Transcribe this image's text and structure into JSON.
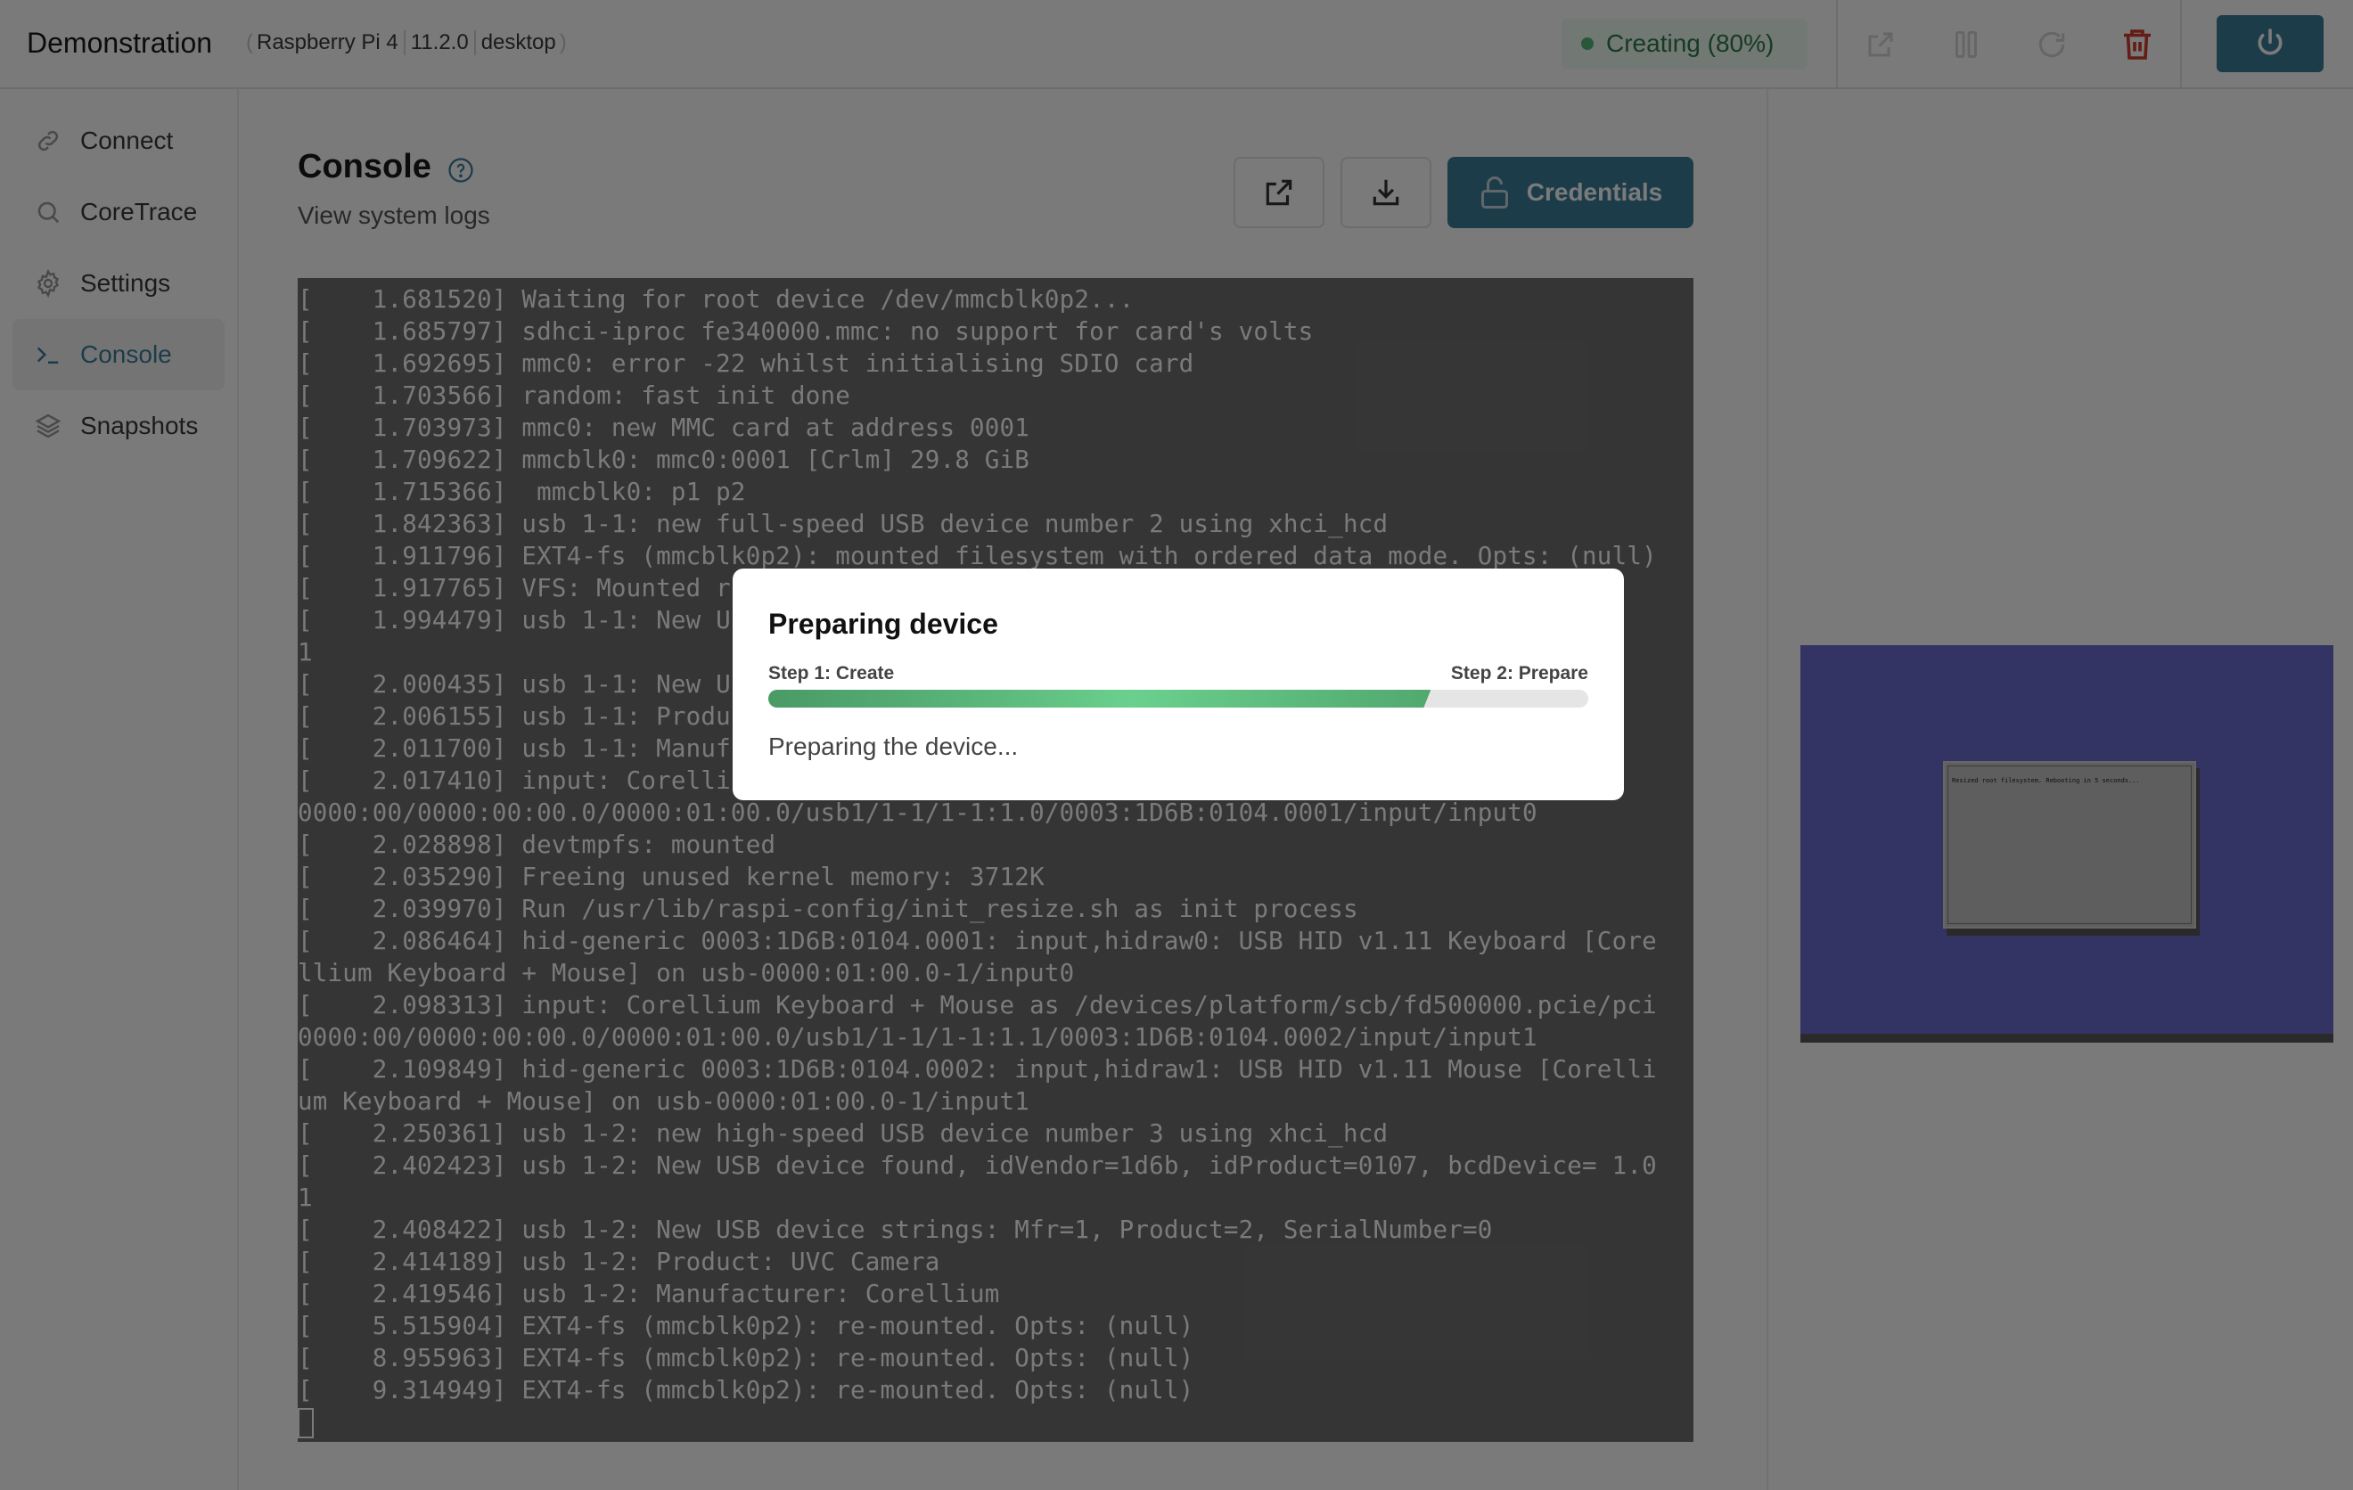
{
  "header": {
    "title": "Demonstration",
    "meta": {
      "model": "Raspberry Pi 4",
      "version": "11.2.0",
      "flavor": "desktop"
    },
    "status": {
      "label": "Creating (80%)",
      "color": "#57b779"
    },
    "icons": [
      "open-external-icon",
      "pause-icon",
      "restart-icon",
      "trash-icon",
      "power-icon"
    ]
  },
  "sidebar": {
    "items": [
      {
        "label": "Connect",
        "icon": "link-icon",
        "active": false
      },
      {
        "label": "CoreTrace",
        "icon": "search-icon",
        "active": false
      },
      {
        "label": "Settings",
        "icon": "gear-icon",
        "active": false
      },
      {
        "label": "Console",
        "icon": "terminal-icon",
        "active": true
      },
      {
        "label": "Snapshots",
        "icon": "layers-icon",
        "active": false
      }
    ]
  },
  "main": {
    "title": "Console",
    "subtitle": "View system logs",
    "buttons": {
      "credentials": "Credentials"
    },
    "console_lines": [
      "[    1.681520] Waiting for root device /dev/mmcblk0p2...",
      "[    1.685797] sdhci-iproc fe340000.mmc: no support for card's volts",
      "[    1.692695] mmc0: error -22 whilst initialising SDIO card",
      "[    1.703566] random: fast init done",
      "[    1.703973] mmc0: new MMC card at address 0001",
      "[    1.709622] mmcblk0: mmc0:0001 [Crlm] 29.8 GiB",
      "[    1.715366]  mmcblk0: p1 p2",
      "[    1.842363] usb 1-1: new full-speed USB device number 2 using xhci_hcd",
      "[    1.911796] EXT4-fs (mmcblk0p2): mounted filesystem with ordered data mode. Opts: (null)",
      "[    1.917765] VFS: Mounted r",
      "[    1.994479] usb 1-1: New U                                                        1.0",
      "1",
      "[    2.000435] usb 1-1: New U",
      "[    2.006155] usb 1-1: Produ",
      "[    2.011700] usb 1-1: Manuf",
      "[    2.017410] input: Corelli                                                        pci",
      "0000:00/0000:00:00.0/0000:01:00.0/usb1/1-1/1-1:1.0/0003:1D6B:0104.0001/input/input0",
      "[    2.028898] devtmpfs: mounted",
      "[    2.035290] Freeing unused kernel memory: 3712K",
      "[    2.039970] Run /usr/lib/raspi-config/init_resize.sh as init process",
      "[    2.086464] hid-generic 0003:1D6B:0104.0001: input,hidraw0: USB HID v1.11 Keyboard [Core",
      "llium Keyboard + Mouse] on usb-0000:01:00.0-1/input0",
      "[    2.098313] input: Corellium Keyboard + Mouse as /devices/platform/scb/fd500000.pcie/pci",
      "0000:00/0000:00:00.0/0000:01:00.0/usb1/1-1/1-1:1.1/0003:1D6B:0104.0002/input/input1",
      "[    2.109849] hid-generic 0003:1D6B:0104.0002: input,hidraw1: USB HID v1.11 Mouse [Corelli",
      "um Keyboard + Mouse] on usb-0000:01:00.0-1/input1",
      "[    2.250361] usb 1-2: new high-speed USB device number 3 using xhci_hcd",
      "[    2.402423] usb 1-2: New USB device found, idVendor=1d6b, idProduct=0107, bcdDevice= 1.0",
      "1",
      "[    2.408422] usb 1-2: New USB device strings: Mfr=1, Product=2, SerialNumber=0",
      "[    2.414189] usb 1-2: Product: UVC Camera",
      "[    2.419546] usb 1-2: Manufacturer: Corellium",
      "[    5.515904] EXT4-fs (mmcblk0p2): re-mounted. Opts: (null)",
      "[    8.955963] EXT4-fs (mmcblk0p2): re-mounted. Opts: (null)",
      "[    9.314949] EXT4-fs (mmcblk0p2): re-mounted. Opts: (null)"
    ]
  },
  "device_screen": {
    "dialog_text": "Resized root filesystem. Rebooting in 5 seconds..."
  },
  "modal": {
    "title": "Preparing device",
    "step1": "Step 1: Create",
    "step2": "Step 2: Prepare",
    "progress_percent": 80,
    "message": "Preparing the device..."
  },
  "colors": {
    "accent": "#3b7e9c",
    "danger": "#d23c2c",
    "success": "#57b779"
  }
}
